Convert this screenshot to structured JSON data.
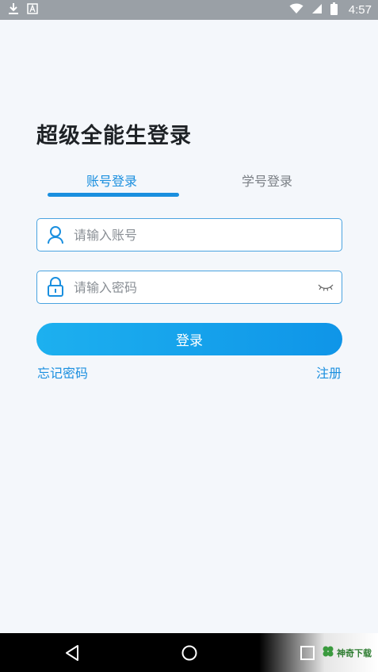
{
  "status_bar": {
    "time": "4:57",
    "icons": [
      "download-icon",
      "a-icon",
      "wifi-icon",
      "signal-icon",
      "battery-icon"
    ]
  },
  "login": {
    "app_title": "超级全能生登录",
    "tabs": [
      {
        "label": "账号登录",
        "active": true
      },
      {
        "label": "学号登录",
        "active": false
      }
    ],
    "account_field": {
      "placeholder": "请输入账号",
      "value": "",
      "icon": "user-icon"
    },
    "password_field": {
      "placeholder": "请输入密码",
      "value": "",
      "icon": "lock-icon",
      "toggle_icon": "eye-closed-icon"
    },
    "login_button_label": "登录",
    "forgot_password_label": "忘记密码",
    "register_label": "注册"
  },
  "nav_bar": {
    "icons": [
      "back-icon",
      "home-icon",
      "recents-icon"
    ]
  },
  "watermark": {
    "text": "神奇下载"
  },
  "colors": {
    "accent": "#1a8fdf",
    "button_start": "#1db0ef",
    "button_end": "#0f95e8",
    "background": "#f4f7fb",
    "status_bar": "#9aa0a6"
  }
}
